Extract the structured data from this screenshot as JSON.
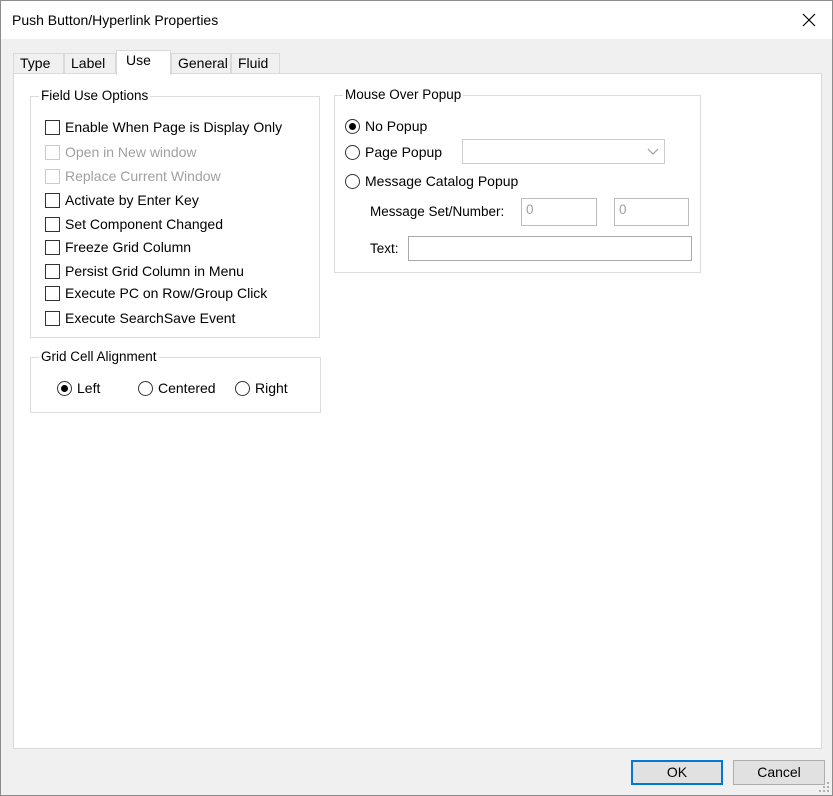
{
  "window": {
    "title": "Push Button/Hyperlink Properties"
  },
  "tabs": [
    {
      "label": "Type",
      "active": false
    },
    {
      "label": "Label",
      "active": false
    },
    {
      "label": "Use",
      "active": true
    },
    {
      "label": "General",
      "active": false
    },
    {
      "label": "Fluid",
      "active": false
    }
  ],
  "field_use_options": {
    "title": "Field Use Options",
    "items": [
      {
        "label": "Enable When Page is Display Only",
        "checked": false,
        "enabled": true
      },
      {
        "label": "Open in New window",
        "checked": false,
        "enabled": false
      },
      {
        "label": "Replace Current Window",
        "checked": false,
        "enabled": false
      },
      {
        "label": "Activate by Enter Key",
        "checked": false,
        "enabled": true
      },
      {
        "label": "Set Component Changed",
        "checked": false,
        "enabled": true
      },
      {
        "label": "Freeze Grid Column",
        "checked": false,
        "enabled": true
      },
      {
        "label": "Persist Grid Column in Menu",
        "checked": false,
        "enabled": true
      },
      {
        "label": "Execute PC on Row/Group Click",
        "checked": false,
        "enabled": true
      },
      {
        "label": "Execute SearchSave Event",
        "checked": false,
        "enabled": true
      }
    ]
  },
  "grid_cell_alignment": {
    "title": "Grid Cell Alignment",
    "options": [
      {
        "label": "Left",
        "selected": true
      },
      {
        "label": "Centered",
        "selected": false
      },
      {
        "label": "Right",
        "selected": false
      }
    ]
  },
  "mouse_over_popup": {
    "title": "Mouse Over Popup",
    "options": [
      {
        "label": "No Popup",
        "selected": true
      },
      {
        "label": "Page Popup",
        "selected": false
      },
      {
        "label": "Message Catalog Popup",
        "selected": false
      }
    ],
    "page_popup_value": "",
    "message_set_label": "Message Set/Number:",
    "message_set_value": "0",
    "message_number_value": "0",
    "text_label": "Text:",
    "text_value": ""
  },
  "buttons": {
    "ok": "OK",
    "cancel": "Cancel"
  },
  "icons": {
    "close": "close-icon",
    "dropdown": "chevron-down-icon",
    "grip": "resize-grip-icon"
  }
}
